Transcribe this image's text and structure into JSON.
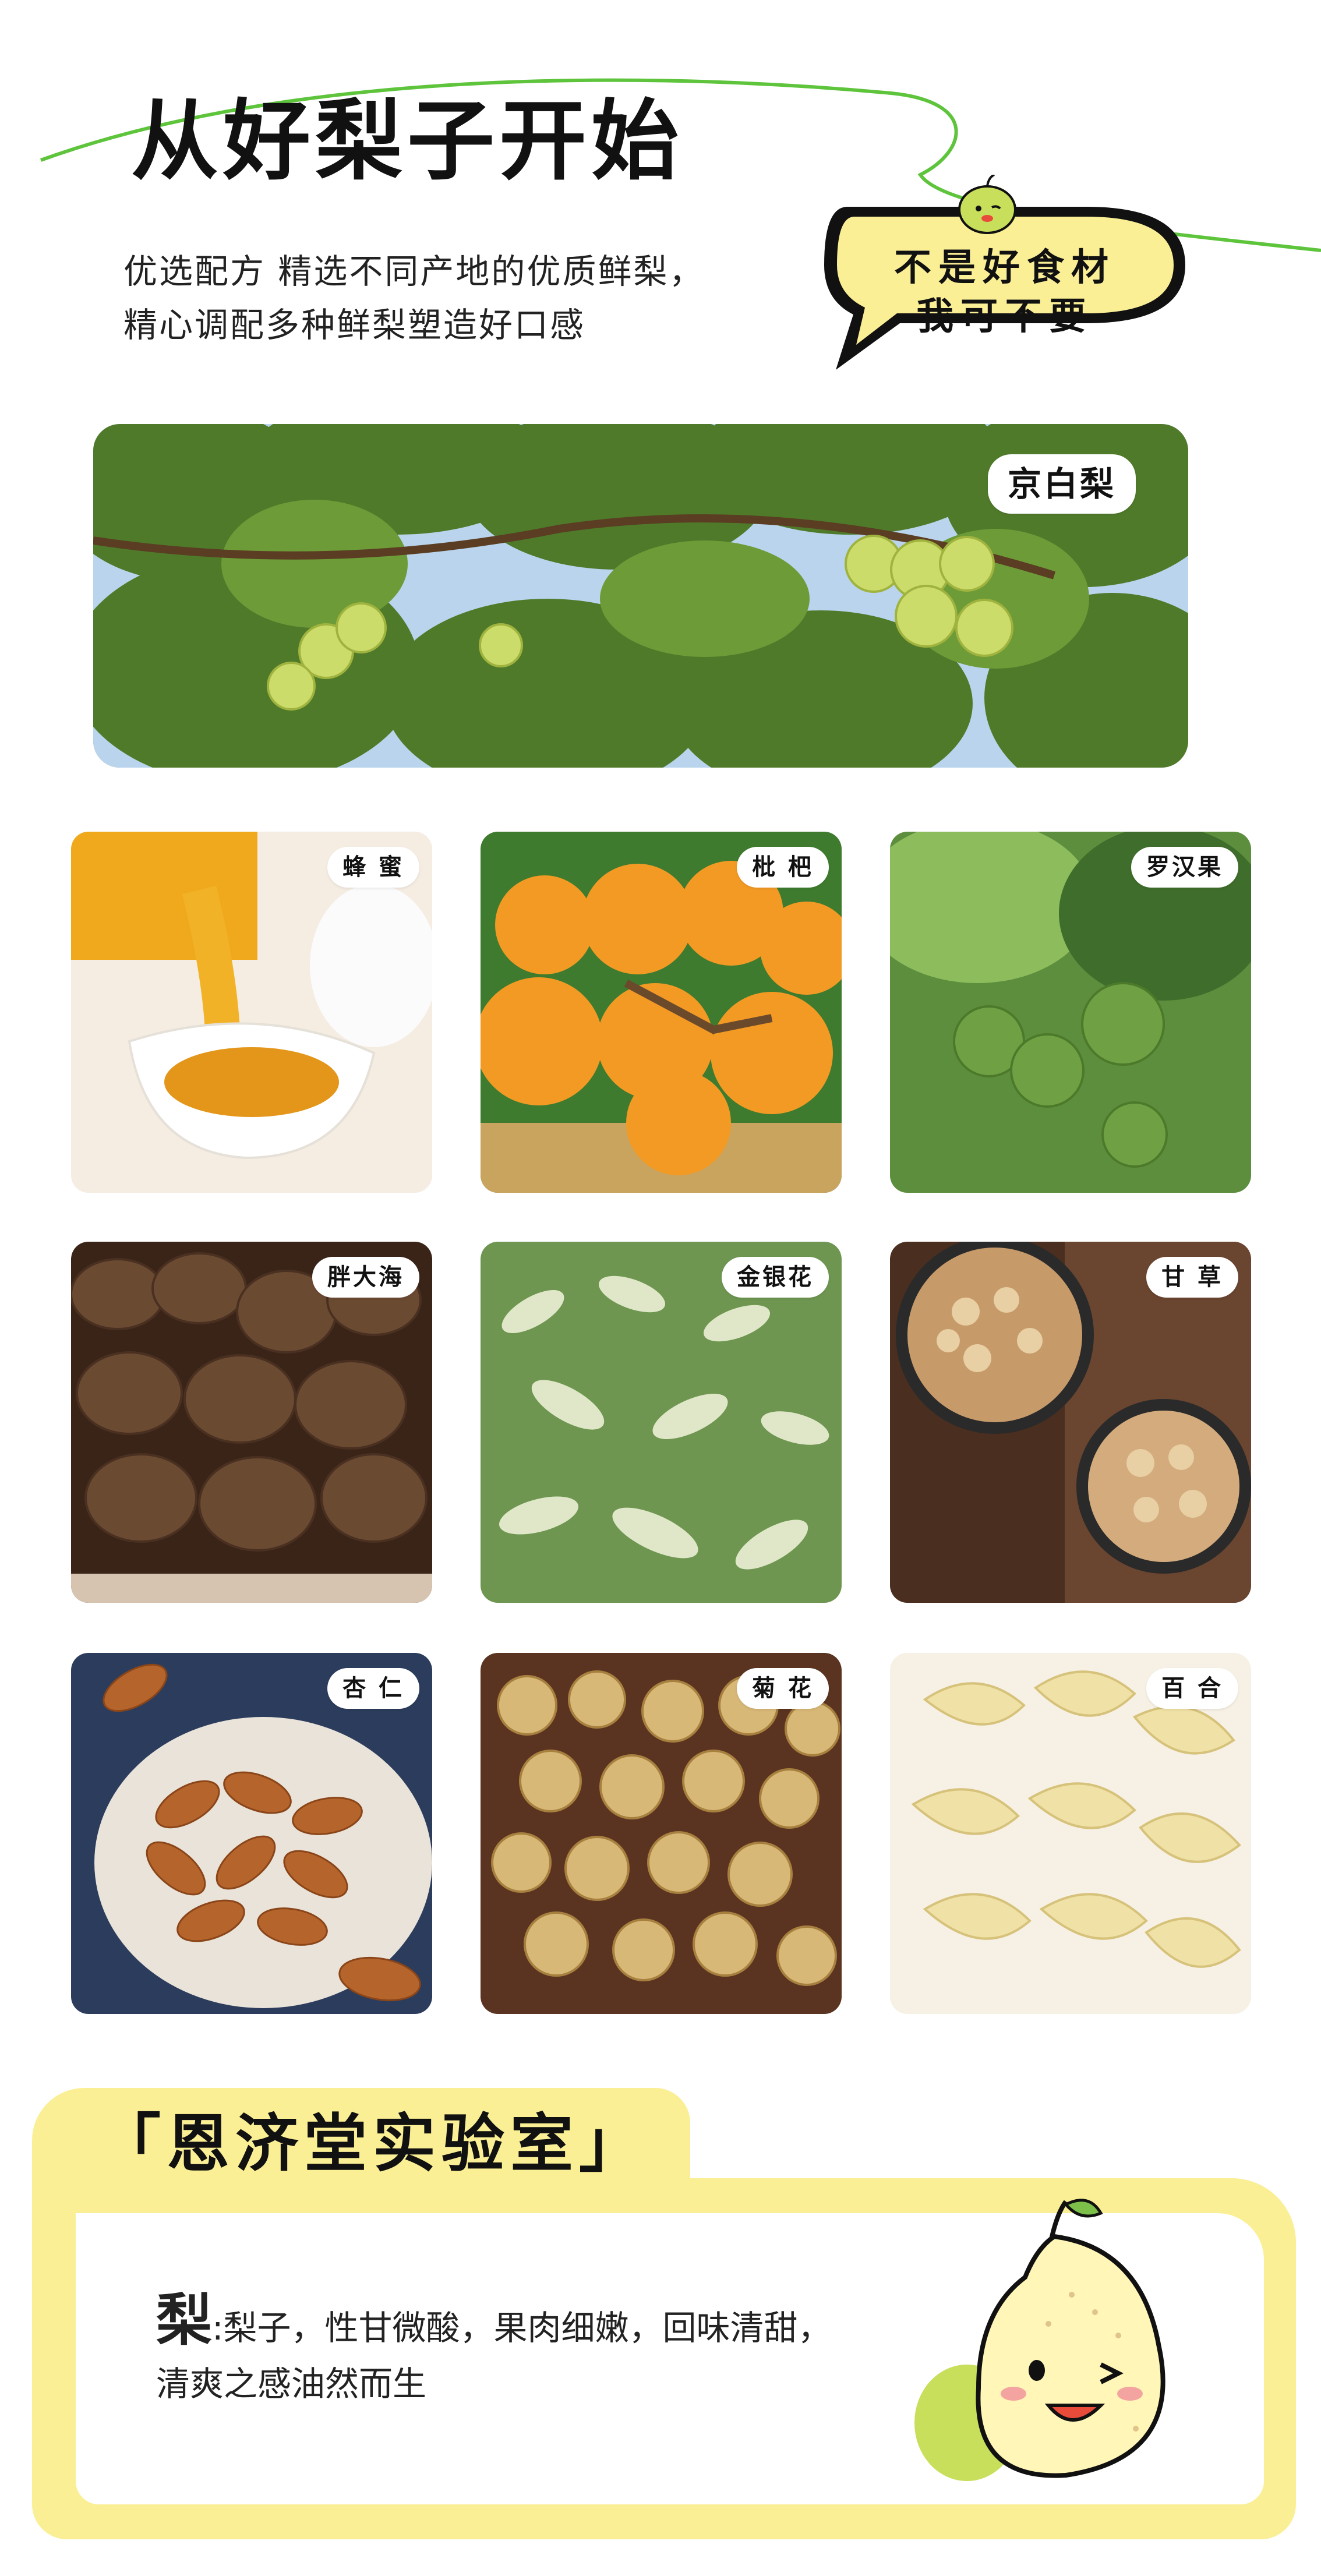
{
  "header": {
    "title": "从好梨子开始",
    "subtitle_line1": "优选配方 精选不同产地的优质鲜梨，",
    "subtitle_line2": "精心调配多种鲜梨塑造好口感"
  },
  "speech_bubble": {
    "line1": "不是好食材",
    "line2": "我可不要"
  },
  "hero": {
    "label": "京白梨"
  },
  "ingredients": [
    {
      "label": "蜂 蜜",
      "icon": "honey-image"
    },
    {
      "label": "枇 杷",
      "icon": "loquat-image"
    },
    {
      "label": "罗汉果",
      "icon": "monk-fruit-image"
    },
    {
      "label": "胖大海",
      "icon": "malva-nut-image"
    },
    {
      "label": "金银花",
      "icon": "honeysuckle-image"
    },
    {
      "label": "甘 草",
      "icon": "licorice-image"
    },
    {
      "label": "杏 仁",
      "icon": "almond-image"
    },
    {
      "label": "菊 花",
      "icon": "chrysanthemum-image"
    },
    {
      "label": "百 合",
      "icon": "lily-bulb-image"
    }
  ],
  "lab": {
    "title": "「恩济堂实验室」",
    "desc_char": "梨",
    "desc_line1": ":梨子，性甘微酸，果肉细嫩，回味清甜，",
    "desc_line2": "清爽之感油然而生"
  },
  "colors": {
    "accent_yellow": "#fbef96",
    "accent_green": "#5ec43c",
    "pear_green": "#c7df5a"
  }
}
